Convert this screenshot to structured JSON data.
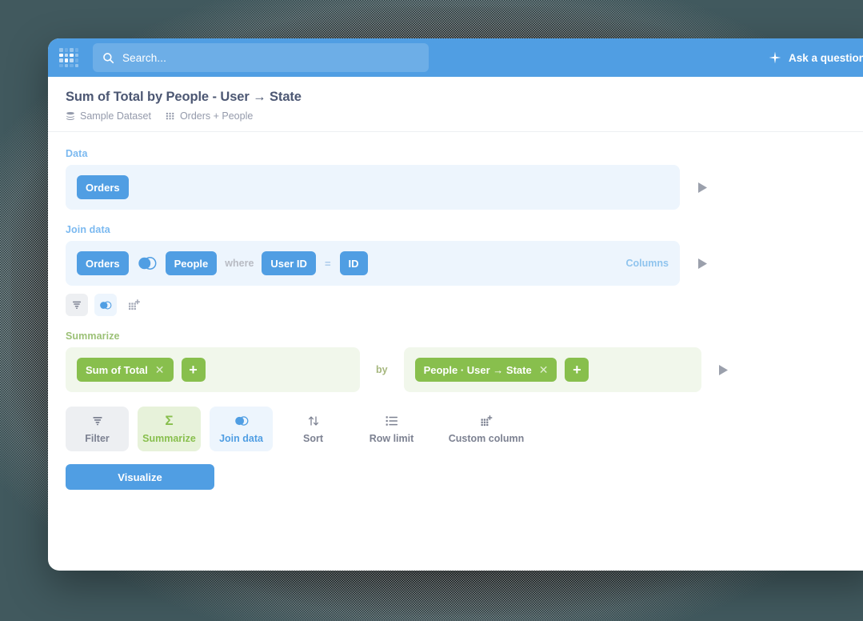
{
  "topnav": {
    "logo_name": "metabase-logo",
    "search": {
      "placeholder": "Search...",
      "value": ""
    },
    "ask_label": "Ask a question"
  },
  "question": {
    "title": "Sum of Total by People - User → State",
    "database": "Sample Dataset",
    "tables": "Orders + People"
  },
  "notebook": {
    "data": {
      "label": "Data",
      "source": "Orders"
    },
    "join": {
      "label": "Join data",
      "left_table": "Orders",
      "right_table": "People",
      "where_word": "where",
      "left_field": "User ID",
      "operator": "=",
      "right_field": "ID",
      "columns_link": "Columns"
    },
    "icon_strip": [
      {
        "name": "filter-icon",
        "state": "grey"
      },
      {
        "name": "join-icon",
        "state": "blue"
      },
      {
        "name": "custom-column-icon",
        "state": "plain"
      }
    ],
    "summarize": {
      "label": "Summarize",
      "metric": "Sum of Total",
      "by_word": "by",
      "dimension": "People · User → State",
      "add_label": "+",
      "remove_label": "✕"
    }
  },
  "actions": [
    {
      "label": "Filter",
      "icon": "filter-icon",
      "style": "grey"
    },
    {
      "label": "Summarize",
      "icon": "sigma-icon",
      "style": "green"
    },
    {
      "label": "Join data",
      "icon": "join-icon",
      "style": "blue"
    },
    {
      "label": "Sort",
      "icon": "sort-icon",
      "style": "plain"
    },
    {
      "label": "Row limit",
      "icon": "list-icon",
      "style": "plain"
    },
    {
      "label": "Custom column",
      "icon": "custom-column-icon",
      "style": "plain"
    }
  ],
  "visualize_label": "Visualize",
  "colors": {
    "brand_blue": "#509EE3",
    "accent_green": "#88BF4D",
    "text_dark": "#4C5773",
    "text_muted": "#949AAB",
    "panel_blue": "#EDF5FD",
    "panel_green": "#F1F7EB",
    "backdrop": "#41595E"
  }
}
